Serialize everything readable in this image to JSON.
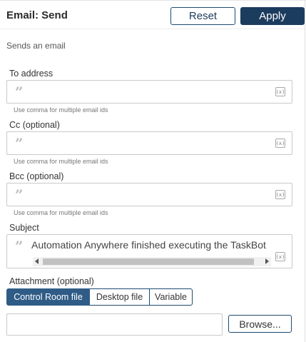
{
  "header": {
    "title": "Email: Send",
    "reset_label": "Reset",
    "apply_label": "Apply"
  },
  "description": "Sends an email",
  "fields": {
    "to": {
      "label": "To address",
      "value": "",
      "hint": "Use comma for multiple email ids"
    },
    "cc": {
      "label": "Cc (optional)",
      "value": "",
      "hint": "Use comma for multiple email ids"
    },
    "bcc": {
      "label": "Bcc (optional)",
      "value": "",
      "hint": "Use comma for multiple email ids"
    },
    "subject": {
      "label": "Subject",
      "value": "Automation Anywhere finished executing the TaskBot"
    }
  },
  "icons": {
    "quote": "”",
    "variable": "(x)"
  },
  "attachment": {
    "label": "Attachment (optional)",
    "options": [
      "Control Room file",
      "Desktop file",
      "Variable"
    ],
    "selected": "Control Room file",
    "file_value": "",
    "browse_label": "Browse..."
  },
  "colors": {
    "accent": "#1c3c5e",
    "active_tab": "#2f5c86"
  }
}
